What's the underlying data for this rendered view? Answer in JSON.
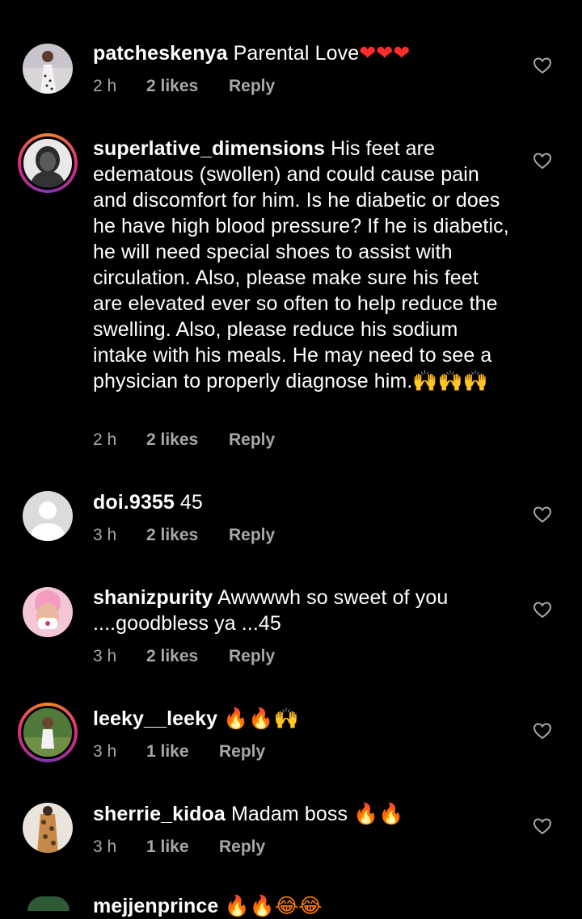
{
  "comments": [
    {
      "username": "patcheskenya",
      "text": "Parental Love",
      "emoji": "❤❤❤",
      "time": "2 h",
      "likes": "2 likes",
      "reply": "Reply"
    },
    {
      "username": "superlative_dimensions",
      "text": "His feet are edematous (swollen) and could cause pain and discomfort for him. Is he diabetic or does he have high blood pressure? If he is diabetic, he will need special shoes to assist with circulation. Also, please make sure his feet are elevated ever so often to help reduce the swelling. Also, please reduce his sodium intake with his meals. He may need to see a physician to properly diagnose him.",
      "emoji": "🙌🙌🙌",
      "time": "2 h",
      "likes": "2 likes",
      "reply": "Reply"
    },
    {
      "username": "doi.9355",
      "text": "45",
      "time": "3 h",
      "likes": "2 likes",
      "reply": "Reply"
    },
    {
      "username": "shanizpurity",
      "text": "Awwwwh so sweet of you ....goodbless ya ...45",
      "time": "3 h",
      "likes": "2 likes",
      "reply": "Reply"
    },
    {
      "username": "leeky__leeky",
      "text": "",
      "emoji": "🔥🔥🙌",
      "time": "3 h",
      "likes": "1 like",
      "reply": "Reply"
    },
    {
      "username": "sherrie_kidoa",
      "text": "Madam boss",
      "emoji": "🔥🔥",
      "time": "3 h",
      "likes": "1 like",
      "reply": "Reply"
    },
    {
      "username": "mejjenprince",
      "text": "",
      "emoji": "🔥🔥😂😂"
    }
  ],
  "icons": {
    "like": "heart-outline-icon"
  },
  "colors": {
    "background": "#000000",
    "text": "#ffffff",
    "meta": "#a8a8a8",
    "heart_red": "#ff2d2d",
    "fire": "#ff7a00"
  }
}
